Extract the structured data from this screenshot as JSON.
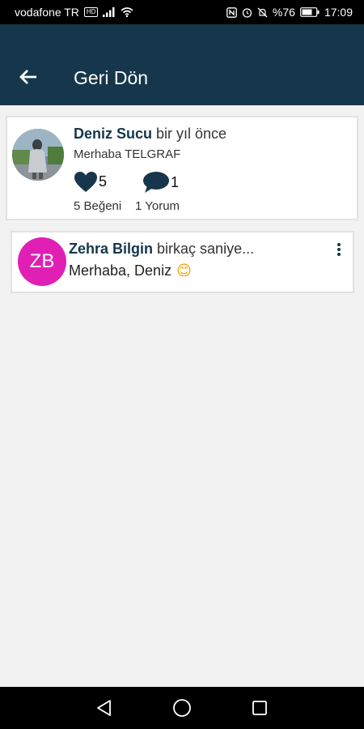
{
  "status_bar": {
    "carrier": "vodafone TR",
    "hd": "HD",
    "battery_percent": "%76",
    "time": "17:09",
    "icons": [
      "signal-icon",
      "wifi-icon",
      "nfc-icon",
      "alarm-icon",
      "mute-icon",
      "battery-icon"
    ]
  },
  "app_bar": {
    "title": "Geri Dön",
    "back_icon": "arrow-left-icon",
    "background": "#16364b"
  },
  "post": {
    "author": "Deniz Sucu",
    "time": "bir yıl önce",
    "text": "Merhaba TELGRAF",
    "like_count": "5",
    "comment_count": "1",
    "like_label": "5 Beğeni",
    "comment_label": "1 Yorum",
    "like_icon": "heart-icon",
    "comment_icon": "speech-bubble-icon"
  },
  "comment": {
    "initials": "ZB",
    "author": "Zehra Bilgin",
    "time": "birkaç saniye...",
    "text": "Merhaba, Deniz",
    "emoji": "😊",
    "avatar_color": "#e01fb4",
    "menu_icon": "more-vertical-icon"
  },
  "nav_bar": {
    "icons": [
      "back-triangle-icon",
      "home-circle-icon",
      "recents-square-icon"
    ]
  }
}
